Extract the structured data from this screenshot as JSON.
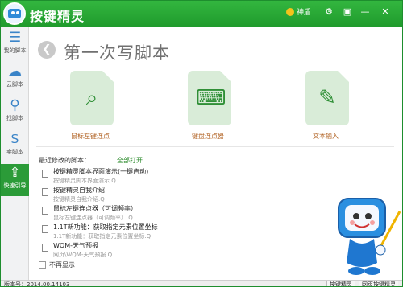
{
  "titlebar": {
    "title": "按键精灵",
    "vip_label": "神盾"
  },
  "sidebar": {
    "items": [
      {
        "label": "我的脚本",
        "icon": "list-icon"
      },
      {
        "label": "云脚本",
        "icon": "cloud-icon"
      },
      {
        "label": "找脚本",
        "icon": "search-icon"
      },
      {
        "label": "卖脚本",
        "icon": "dollar-icon"
      },
      {
        "label": "快速引导",
        "icon": "signpost-icon",
        "active": true
      }
    ]
  },
  "main": {
    "title": "第一次写脚本",
    "cards": [
      {
        "label": "鼠标左键连点",
        "icon": "mouse-icon"
      },
      {
        "label": "键盘连点器",
        "icon": "keyboard-icon"
      },
      {
        "label": "文本输入",
        "icon": "edit-icon"
      }
    ],
    "recent_header": "最近修改的脚本：",
    "open_all": "全部打开",
    "scripts": [
      {
        "name": "按键精灵脚本界面演示(一键启动)",
        "desc": "按键精灵脚本界面演示.Q"
      },
      {
        "name": "按键精灵自我介绍",
        "desc": "按键精灵自我介绍.Q"
      },
      {
        "name": "鼠标左键连点器（可调频率）",
        "desc": "鼠标左键连点器（可调频率）.Q"
      },
      {
        "name": "1.1T新功能：获取指定元素位置坐标",
        "desc": "1.1T新功能：获取指定元素位置坐标.Q"
      },
      {
        "name": "WQM-天气预报",
        "desc": "网页\\WQM-天气预报.Q"
      }
    ],
    "no_show": "不再显示"
  },
  "statusbar": {
    "version": "版本号：2014.00.14103",
    "btn_wizard": "按键精灵",
    "btn_web": "网页按键精灵"
  }
}
